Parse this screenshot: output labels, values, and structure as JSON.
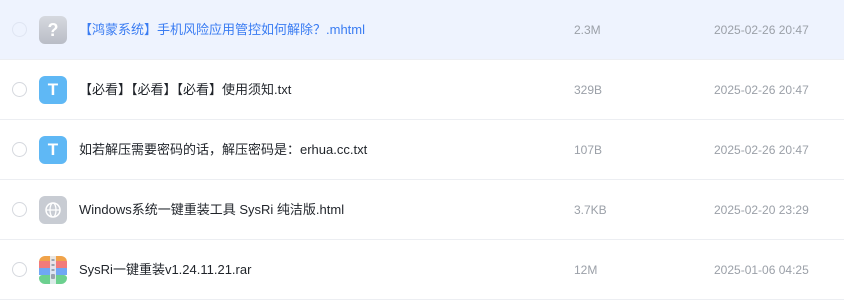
{
  "files": [
    {
      "name": "【鸿蒙系统】手机风险应用管控如何解除？.mhtml",
      "size": "2.3M",
      "date": "2025-02-26 20:47",
      "icon": "unknown-file-icon",
      "icon_glyph": "?",
      "selected": true
    },
    {
      "name": "【必看】【必看】【必看】使用须知.txt",
      "size": "329B",
      "date": "2025-02-26 20:47",
      "icon": "txt-file-icon",
      "icon_glyph": "T"
    },
    {
      "name": "如若解压需要密码的话，解压密码是：erhua.cc.txt",
      "size": "107B",
      "date": "2025-02-26 20:47",
      "icon": "txt-file-icon",
      "icon_glyph": "T"
    },
    {
      "name": "Windows系统一键重装工具 SysRi 纯洁版.html",
      "size": "3.7KB",
      "date": "2025-02-20 23:29",
      "icon": "globe-file-icon"
    },
    {
      "name": "SysRi一键重装v1.24.11.21.rar",
      "size": "12M",
      "date": "2025-01-06 04:25",
      "icon": "archive-file-icon"
    }
  ],
  "colors": {
    "selected_row_bg": "#eef3fe",
    "selected_text": "#3a7cf2",
    "txt_icon": "#5fb8f5",
    "meta_text": "#9ba0a8"
  }
}
